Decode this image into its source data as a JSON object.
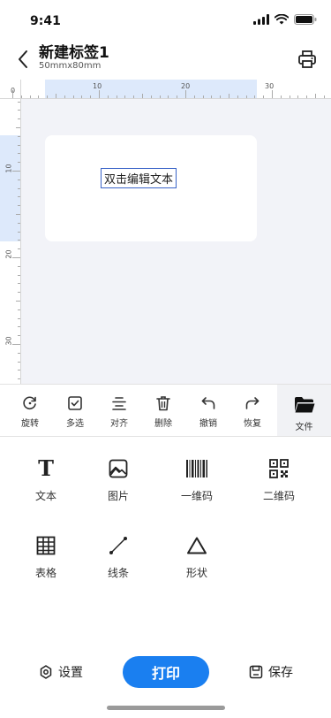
{
  "status_bar": {
    "time": "9:41"
  },
  "header": {
    "title": "新建标签1",
    "subtitle": "50mmx80mm"
  },
  "rulers": {
    "top_labels": [
      "0",
      "10",
      "20",
      "30"
    ],
    "left_labels": [
      "10",
      "20",
      "30"
    ]
  },
  "canvas": {
    "text_element": "双击编辑文本"
  },
  "toolbar": {
    "items": [
      {
        "label": "旋转",
        "icon": "rotate-icon"
      },
      {
        "label": "多选",
        "icon": "checkbox-icon"
      },
      {
        "label": "对齐",
        "icon": "align-icon"
      },
      {
        "label": "删除",
        "icon": "trash-icon"
      },
      {
        "label": "撤销",
        "icon": "undo-icon"
      },
      {
        "label": "恢复",
        "icon": "redo-icon"
      },
      {
        "label": "文件",
        "icon": "folder-icon"
      }
    ]
  },
  "palette": {
    "items": [
      {
        "label": "文本",
        "icon": "text-icon"
      },
      {
        "label": "图片",
        "icon": "image-icon"
      },
      {
        "label": "一维码",
        "icon": "barcode-icon"
      },
      {
        "label": "二维码",
        "icon": "qrcode-icon"
      },
      {
        "label": "表格",
        "icon": "table-icon"
      },
      {
        "label": "线条",
        "icon": "line-icon"
      },
      {
        "label": "形状",
        "icon": "triangle-icon"
      }
    ]
  },
  "bottom_bar": {
    "settings_label": "设置",
    "print_label": "打印",
    "save_label": "保存"
  },
  "colors": {
    "primary": "#1a7ff0",
    "ruler_highlight": "#dde9fb",
    "canvas_bg": "#f2f3f8"
  }
}
